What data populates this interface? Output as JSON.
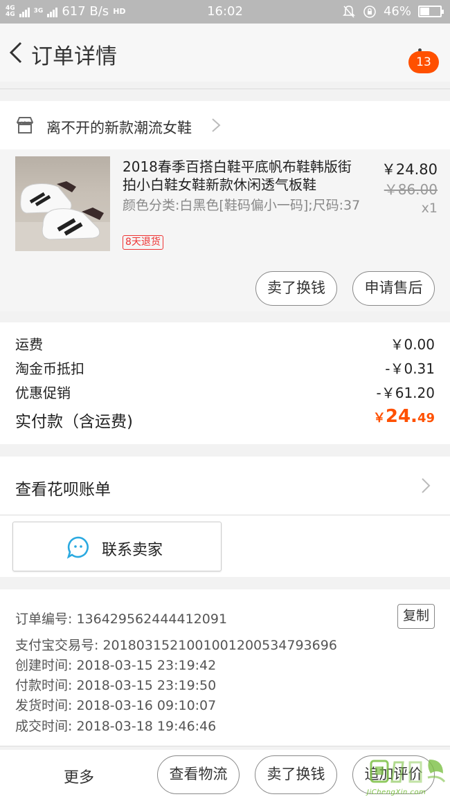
{
  "status_bar": {
    "network_1": "4G",
    "network_2": "4G",
    "network_3": "3G",
    "speed": "617 B/s",
    "hd": "HD",
    "time": "16:02",
    "battery": "46%",
    "battery_level": 0.46
  },
  "header": {
    "title": "订单详情",
    "badge": "13"
  },
  "shop": {
    "name": "离不开的新款潮流女鞋"
  },
  "item": {
    "title": "2018春季百搭白鞋平底帆布鞋韩版街拍小白鞋女鞋新款休闲透气板鞋",
    "spec": "颜色分类:白黑色[鞋码偏小一码];尺码:37",
    "refund_tag": "8天退货",
    "price": "￥24.80",
    "original_price": "￥86.00",
    "quantity": "x1",
    "actions": [
      "卖了换钱",
      "申请售后"
    ]
  },
  "fees": [
    {
      "label": "运费",
      "value": "￥0.00"
    },
    {
      "label": "淘金币抵扣",
      "value": "-￥0.31"
    },
    {
      "label": "优惠促销",
      "value": "-￥61.20"
    }
  ],
  "total": {
    "label": "实付款（含运费)",
    "currency": "￥",
    "integer": "24.",
    "decimal": "49"
  },
  "huabei": {
    "label": "查看花呗账单"
  },
  "contact": {
    "label": "联系卖家"
  },
  "order_info": {
    "copy_label": "复制",
    "lines": [
      "订单编号: 136429562444412091",
      "支付宝交易号: 2018031521001001200534793696",
      "创建时间: 2018-03-15 23:19:42",
      "付款时间: 2018-03-15 23:19:50",
      "发货时间: 2018-03-16 09:10:07",
      "成交时间: 2018-03-18 19:46:46"
    ]
  },
  "bottom_bar": {
    "more": "更多",
    "buttons": [
      "查看物流",
      "卖了换钱",
      "追加评价"
    ]
  },
  "watermark": {
    "text": "JiChengXin.com"
  },
  "colors": {
    "accent": "#ff5000",
    "refund_tag": "#e33333",
    "chat_icon": "#2aa9e0"
  }
}
